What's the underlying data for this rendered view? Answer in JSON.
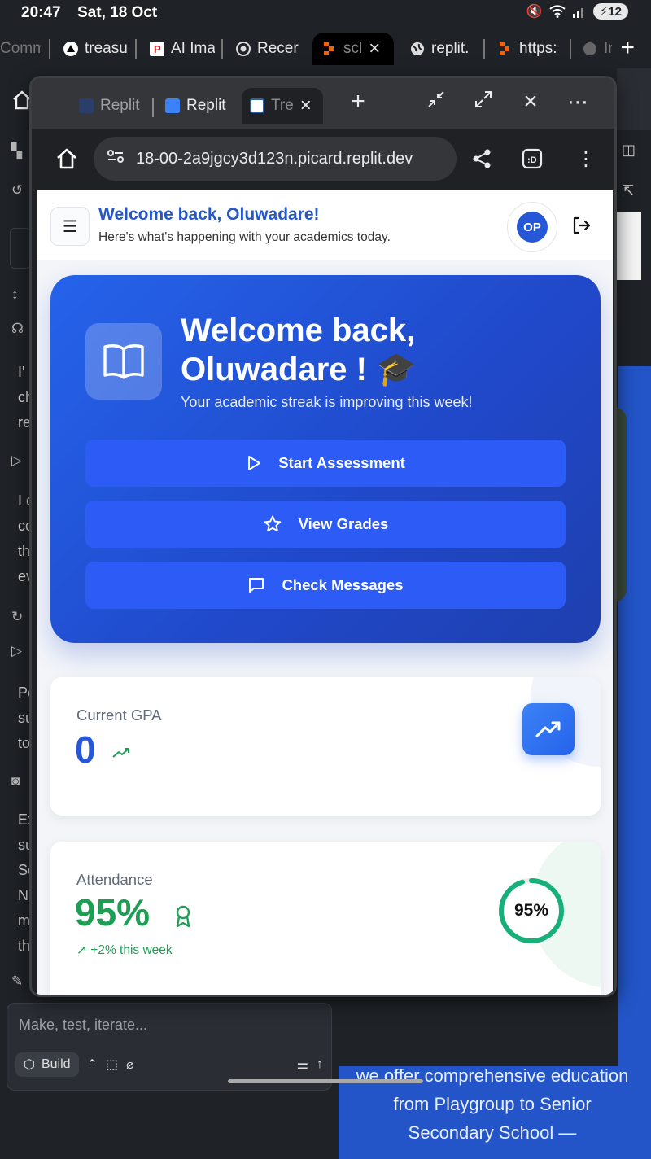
{
  "status": {
    "time": "20:47",
    "date": "Sat, 18 Oct",
    "battery": "12"
  },
  "outer_tabs": [
    {
      "label": "Comm"
    },
    {
      "label": "treasu"
    },
    {
      "label": "AI Ima"
    },
    {
      "label": "Recer"
    },
    {
      "label": "scl"
    },
    {
      "label": "replit."
    },
    {
      "label": "https:"
    },
    {
      "label": "In"
    }
  ],
  "bg": {
    "left_letters": [
      "I'",
      "ch",
      "re",
      "I c",
      "co",
      "th",
      "ev",
      "Pe",
      "su",
      "to",
      "Ex",
      "su",
      "Sc",
      "N",
      "m",
      "th"
    ],
    "right_text": "we offer comprehensive education from Playgroup to Senior Secondary School —",
    "composer_placeholder": "Make, test, iterate...",
    "build_label": "Build"
  },
  "window": {
    "tabs": [
      {
        "label": "Replit"
      },
      {
        "label": "Replit"
      },
      {
        "label": "Tre"
      }
    ],
    "url": "18-00-2a9jgcy3d123n.picard.replit.dev"
  },
  "app": {
    "header_title": "Welcome back, Oluwadare!",
    "header_subtitle": "Here's what's happening with your academics today.",
    "avatar_initials": "OP",
    "hero": {
      "title_line1": "Welcome back,",
      "title_line2": "Oluwadare ! 🎓",
      "subtitle": "Your academic streak is improving this week!",
      "buttons": [
        {
          "label": "Start Assessment",
          "icon": "play-icon"
        },
        {
          "label": "View Grades",
          "icon": "star-icon"
        },
        {
          "label": "Check Messages",
          "icon": "message-icon"
        }
      ]
    },
    "gpa": {
      "label": "Current GPA",
      "value": "0"
    },
    "attendance": {
      "label": "Attendance",
      "value": "95%",
      "change": "↗ +2% this week",
      "ring_label": "95%",
      "ring_fraction": 0.95
    }
  },
  "colors": {
    "primary": "#2557d6",
    "success": "#1e9e55",
    "hero_btn": "#2c5cf5"
  }
}
